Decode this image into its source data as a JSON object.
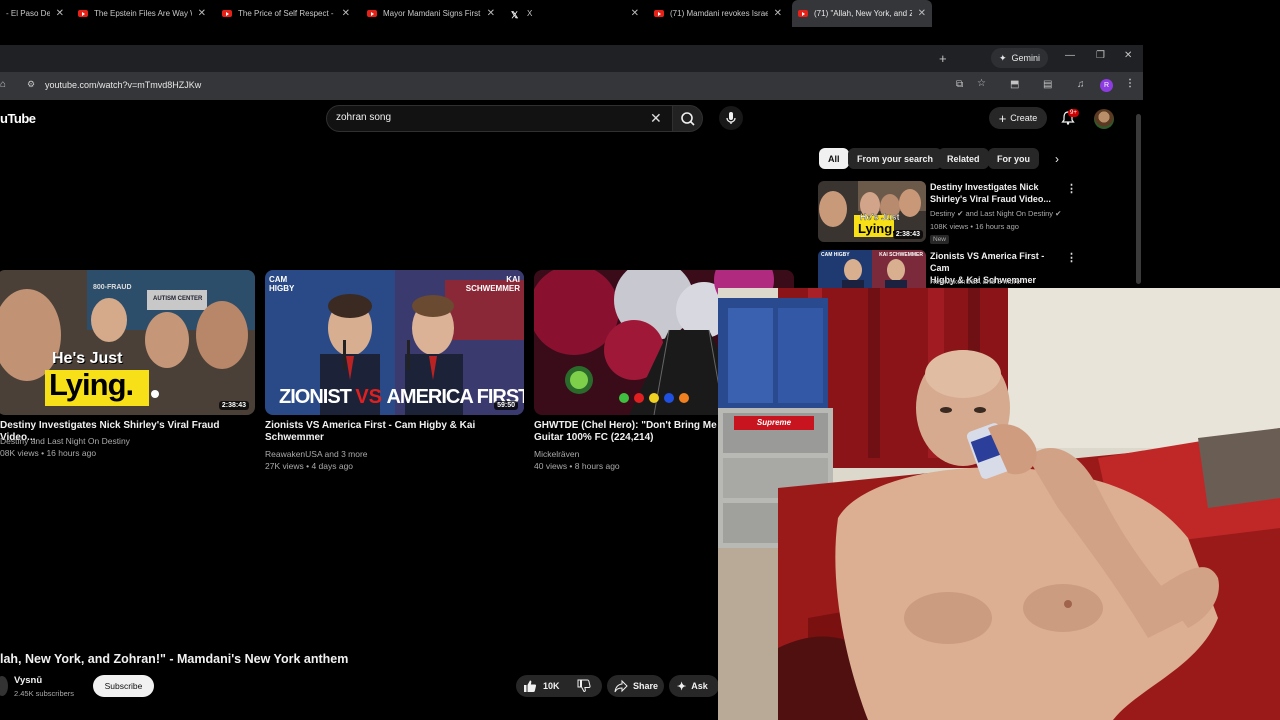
{
  "browser": {
    "tabs": [
      {
        "title": "- El Paso Del",
        "icon": "youtube-icon",
        "active": false
      },
      {
        "title": "The Epstein Files Are Way W",
        "icon": "youtube-icon",
        "active": false
      },
      {
        "title": "The Price of Self Respect - Yo",
        "icon": "youtube-icon",
        "active": false
      },
      {
        "title": "Mayor Mamdani Signs First T",
        "icon": "youtube-icon",
        "active": false
      },
      {
        "title": "X",
        "icon": "x-icon",
        "active": false
      },
      {
        "title": "(71) Mamdani revokes Israel",
        "icon": "youtube-icon",
        "active": false
      },
      {
        "title": "(71) \"Allah, New York, and Zo",
        "icon": "youtube-icon",
        "active": true
      }
    ],
    "new_tab_symbol": "+",
    "gemini_label": "Gemini",
    "url": "youtube.com/watch?v=mTmvd8HZJKw",
    "profile_initial": "R"
  },
  "youtube": {
    "logo_text": "uTube",
    "search_value": "zohran song",
    "create_label": "Create",
    "notifications_badge": "9+",
    "chips": [
      "All",
      "From your search",
      "Related",
      "For you"
    ],
    "sidebar_videos": [
      {
        "title_line1": "Destiny Investigates Nick",
        "title_line2": "Shirley's Viral Fraud Video...",
        "channel": "Destiny",
        "channel_suffix": "and Last Night On Destiny",
        "meta": "108K views • 16 hours ago",
        "badge": "New",
        "duration": "2:38:43",
        "thumb_caption_top": "He's Just",
        "thumb_caption_bottom": "Lying."
      },
      {
        "title_line1": "Zionists VS America First - Cam",
        "title_line2": "Higby & Kai Schwemmer",
        "channel": "ReawakenUSA and 3 more",
        "thumb_caption_left": "CAM HIGBY",
        "thumb_caption_right": "KAI SCHWEMMER"
      }
    ],
    "endscreen": [
      {
        "title_line1": "Destiny Investigates Nick Shirley's Viral Fraud Video...",
        "title_line2": "",
        "channel": "Destiny and Last Night On Destiny",
        "meta": "08K views • 16 hours ago",
        "duration": "2:38:43",
        "thumb_caption_top": "He's Just",
        "thumb_caption_bottom": "Lying.",
        "sign_text": "800-FRAUD",
        "sign_text_2": "AUTISM CENTER"
      },
      {
        "title_line1": "Zionists VS America First - Cam Higby & Kai",
        "title_line2": "Schwemmer",
        "channel": "ReawakenUSA and 3 more",
        "meta": "27K views • 4 days ago",
        "duration": "59:50",
        "thumb_caption_left": "CAM HIGBY",
        "thumb_caption_right": "KAI SCHWEMMER",
        "thumb_caption_a": "ZIONIST",
        "thumb_caption_vs": "VS",
        "thumb_caption_b": "AMERICA FIRST"
      },
      {
        "title_line1": "GHWTDE (Chel Hero): \"Don't Bring Me D",
        "title_line2": "Guitar 100% FC (224,214)",
        "channel": "Mickelräven",
        "meta": "40 views • 8 hours ago"
      }
    ],
    "video_title": "lah, New York, and Zohran!\" - Mamdani's New York anthem",
    "channel_name": "Vysnū",
    "channel_subs": "2.45K subscribers",
    "subscribe_label": "Subscribe",
    "like_count": "10K",
    "share_label": "Share",
    "ask_label": "Ask"
  },
  "webcam": {
    "can_label": "",
    "box_label": "Supreme"
  },
  "colors": {
    "youtube_red": "#ff0000",
    "chrome_bg": "#202124",
    "accent_yellow": "#f7e017"
  }
}
